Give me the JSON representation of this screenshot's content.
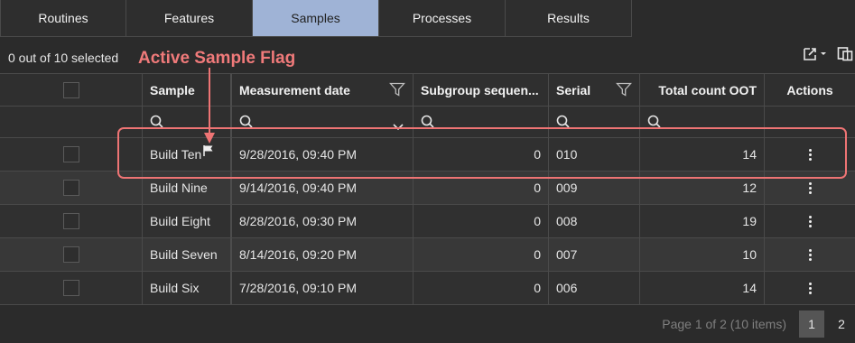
{
  "tabs": [
    {
      "label": "Routines",
      "active": false
    },
    {
      "label": "Features",
      "active": false
    },
    {
      "label": "Samples",
      "active": true
    },
    {
      "label": "Processes",
      "active": false
    },
    {
      "label": "Results",
      "active": false
    }
  ],
  "toolbar": {
    "selection_text": "0 out of 10 selected",
    "export_icon": "export-icon",
    "columns_icon": "column-chooser-icon"
  },
  "annotation": {
    "label": "Active Sample Flag",
    "color": "#ee7474"
  },
  "grid": {
    "columns": [
      "Sample",
      "Measurement date",
      "Subgroup sequen...",
      "Serial",
      "Total count OOT",
      "Actions"
    ],
    "rows": [
      {
        "sample": "Build Ten",
        "date": "9/28/2016,  09:40 PM",
        "subgroup": "0",
        "serial": "010",
        "total": "14",
        "active_flag": true
      },
      {
        "sample": "Build Nine",
        "date": "9/14/2016,  09:40 PM",
        "subgroup": "0",
        "serial": "009",
        "total": "12",
        "active_flag": false
      },
      {
        "sample": "Build Eight",
        "date": "8/28/2016,  09:30 PM",
        "subgroup": "0",
        "serial": "008",
        "total": "19",
        "active_flag": false
      },
      {
        "sample": "Build Seven",
        "date": "8/14/2016,  09:20 PM",
        "subgroup": "0",
        "serial": "007",
        "total": "10",
        "active_flag": false
      },
      {
        "sample": "Build Six",
        "date": "7/28/2016,  09:10 PM",
        "subgroup": "0",
        "serial": "006",
        "total": "14",
        "active_flag": false
      }
    ]
  },
  "pager": {
    "info": "Page 1 of 2 (10 items)",
    "pages": [
      "1",
      "2"
    ],
    "current": "1"
  },
  "colors": {
    "active_tab": "#9fb3d6",
    "annotation": "#ee7474",
    "background": "#2b2b2b"
  }
}
